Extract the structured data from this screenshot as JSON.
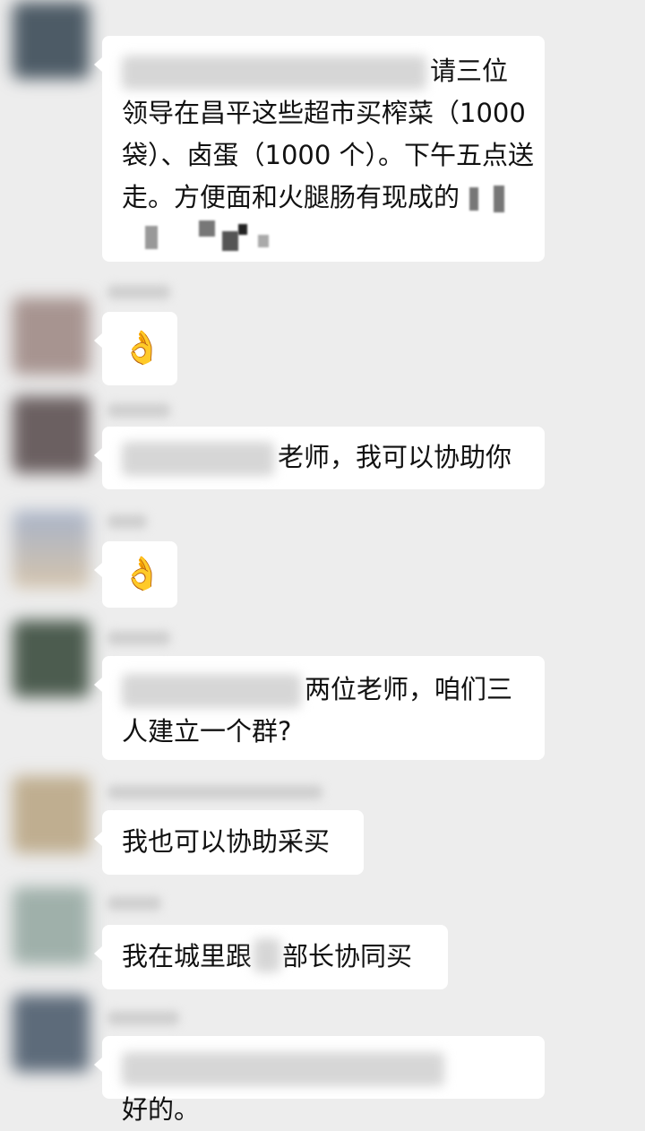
{
  "messages": [
    {
      "text_line1": "请三位",
      "text_line2": "领导在昌平这些超市买榨菜（1000",
      "text_line3": "袋）、卤蛋（1000 个）。下午五点送",
      "text_line4": "走。方便面和火腿肠有现成的"
    },
    {
      "emoji": "👌"
    },
    {
      "text": "老师，我可以协助你"
    },
    {
      "emoji": "👌"
    },
    {
      "text_line1": "两位老师，咱们三",
      "text_line2": "人建立一个群?"
    },
    {
      "text": "我也可以协助采买"
    },
    {
      "text_before": "我在城里跟",
      "text_after": "部长协同买"
    },
    {
      "text": "好的。"
    }
  ],
  "colors": {
    "background": "#ededed",
    "bubble": "#ffffff",
    "text": "#111111"
  }
}
